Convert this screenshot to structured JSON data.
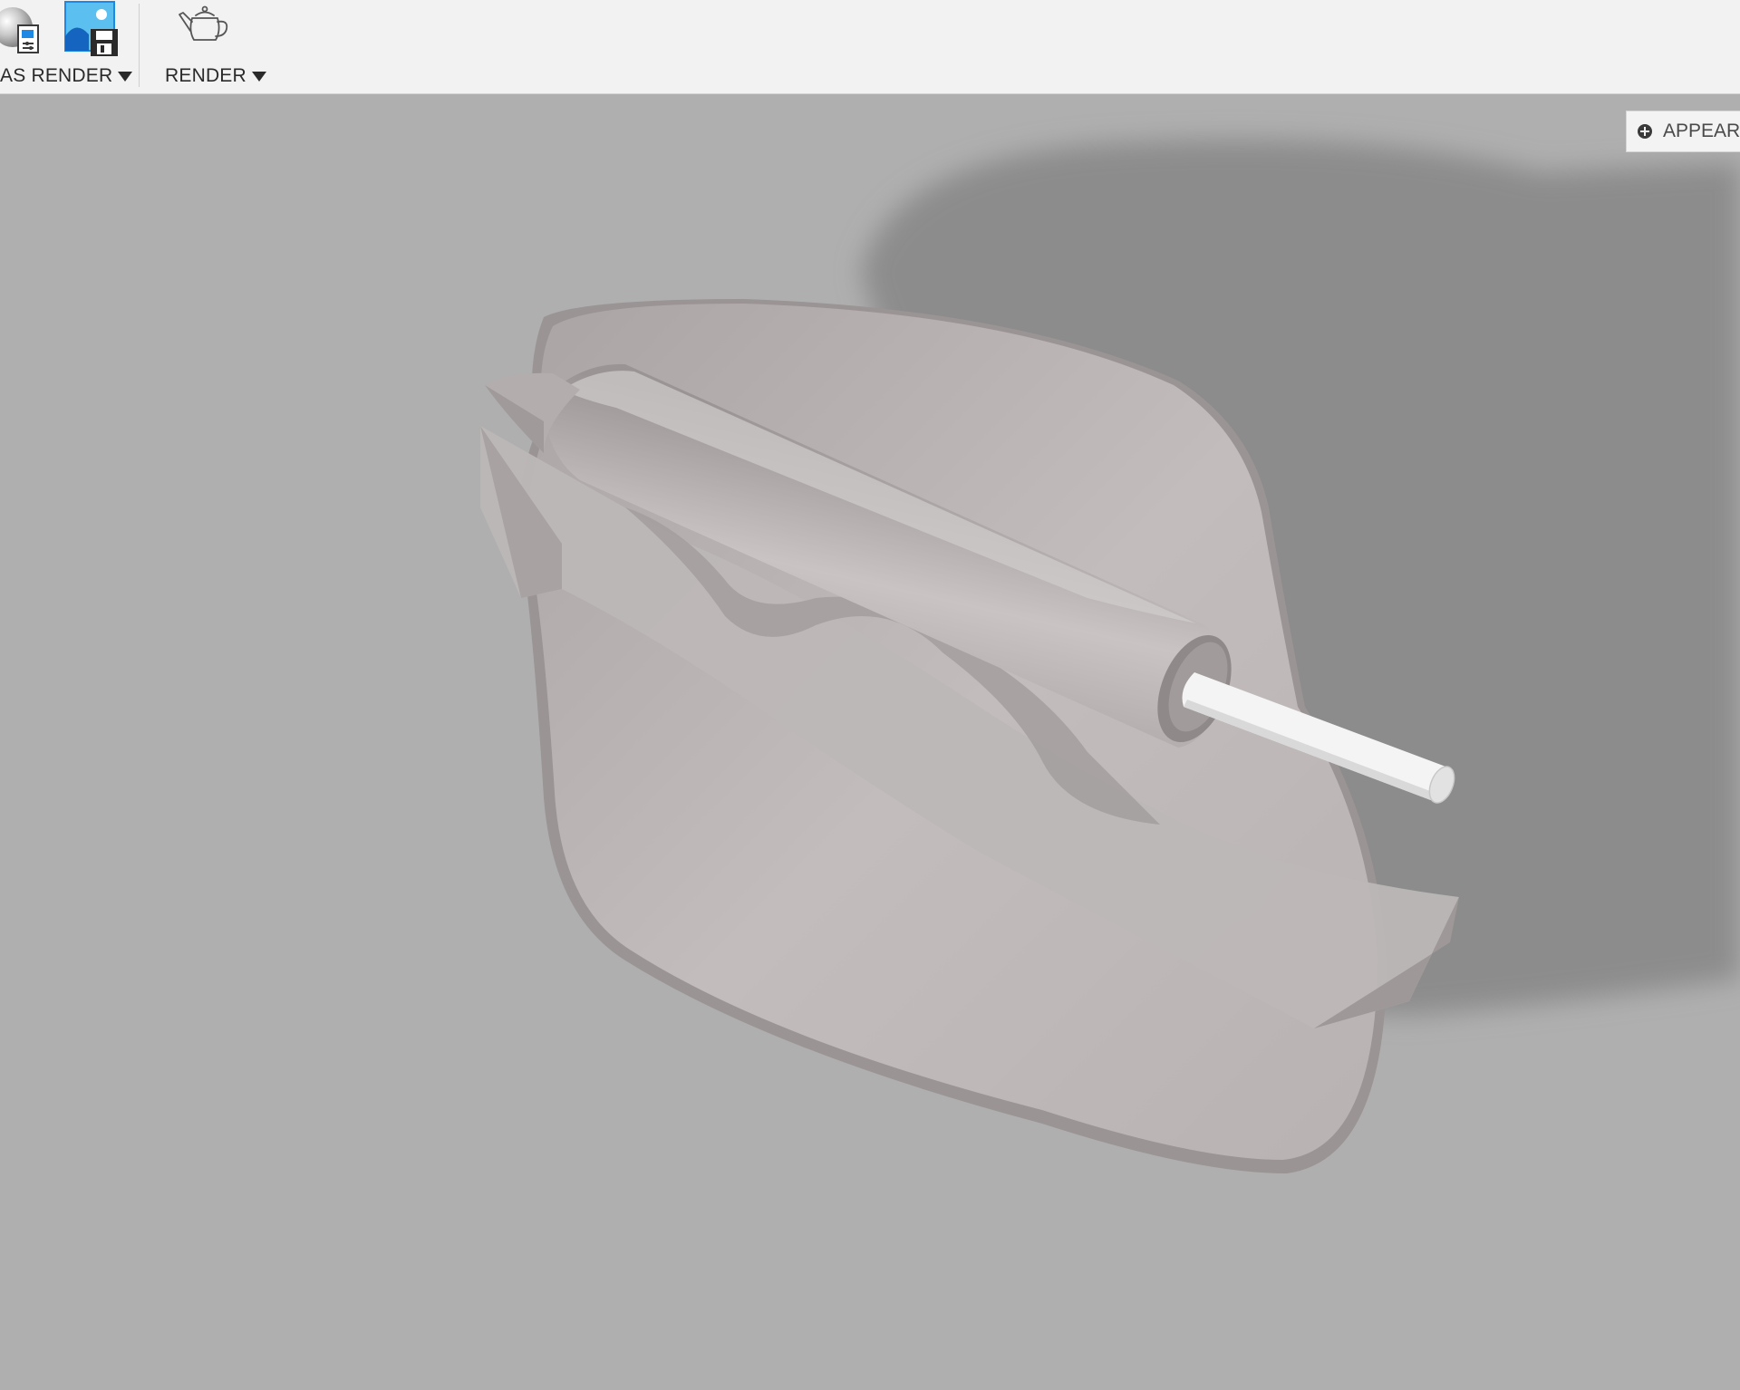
{
  "toolbar": {
    "groups": [
      {
        "label": "AS RENDER",
        "icons": [
          "render-settings-icon",
          "save-image-icon"
        ]
      },
      {
        "label": "RENDER",
        "icons": [
          "teapot-render-icon"
        ]
      }
    ]
  },
  "panel": {
    "appearance_label": "APPEARA"
  },
  "colors": {
    "toolbar_bg": "#f2f2f2",
    "canvas_bg": "#afafaf",
    "model": "#c4bebe",
    "shadow": "#8e8e8e",
    "accent_blue": "#1e88e5"
  }
}
